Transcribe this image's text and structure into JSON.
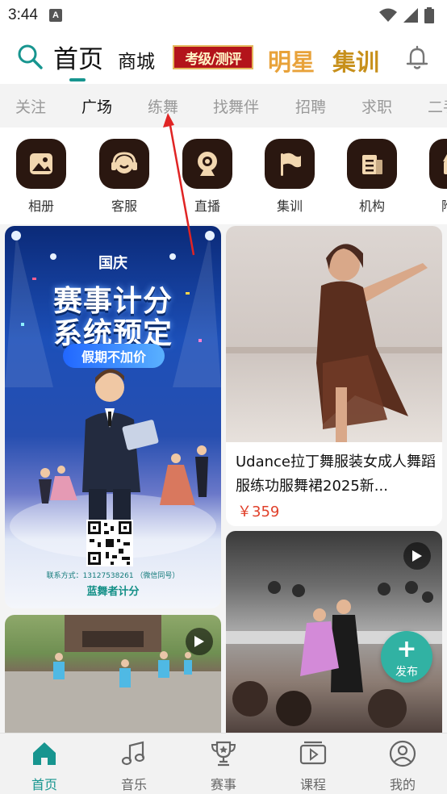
{
  "status_bar": {
    "time": "3:44",
    "notification_badge": "A"
  },
  "header": {
    "home_label": "首页",
    "mall_label": "商城",
    "exam_label": "考级/测评",
    "star_label": "明星",
    "train_label": "集训",
    "accent_color": "#17958f"
  },
  "tabs": [
    {
      "label": "关注"
    },
    {
      "label": "广场"
    },
    {
      "label": "练舞"
    },
    {
      "label": "找舞伴"
    },
    {
      "label": "招聘"
    },
    {
      "label": "求职"
    },
    {
      "label": "二手"
    }
  ],
  "quick_links": [
    {
      "label": "相册",
      "icon": "album-icon"
    },
    {
      "label": "客服",
      "icon": "headset-icon"
    },
    {
      "label": "直播",
      "icon": "webcam-icon"
    },
    {
      "label": "集训",
      "icon": "flag-icon"
    },
    {
      "label": "机构",
      "icon": "building-icon"
    },
    {
      "label": "附近",
      "icon": "shop-icon"
    }
  ],
  "feed": {
    "poster": {
      "badge": "国庆",
      "title_line1": "赛事计分",
      "title_line2": "系统预定",
      "pill": "假期不加价",
      "contact": "联系方式：13127538261 （微信同号）",
      "brand": "蓝舞者计分"
    },
    "product": {
      "title": "Udance拉丁舞服装女成人舞蹈服练功服舞裙2025新...",
      "price": "￥359",
      "price_color": "#e0402a"
    },
    "publish_button": {
      "label": "发布"
    }
  },
  "bottom_nav": [
    {
      "label": "首页",
      "icon": "home-icon"
    },
    {
      "label": "音乐",
      "icon": "music-icon"
    },
    {
      "label": "赛事",
      "icon": "trophy-icon"
    },
    {
      "label": "课程",
      "icon": "course-icon"
    },
    {
      "label": "我的",
      "icon": "profile-icon"
    }
  ]
}
